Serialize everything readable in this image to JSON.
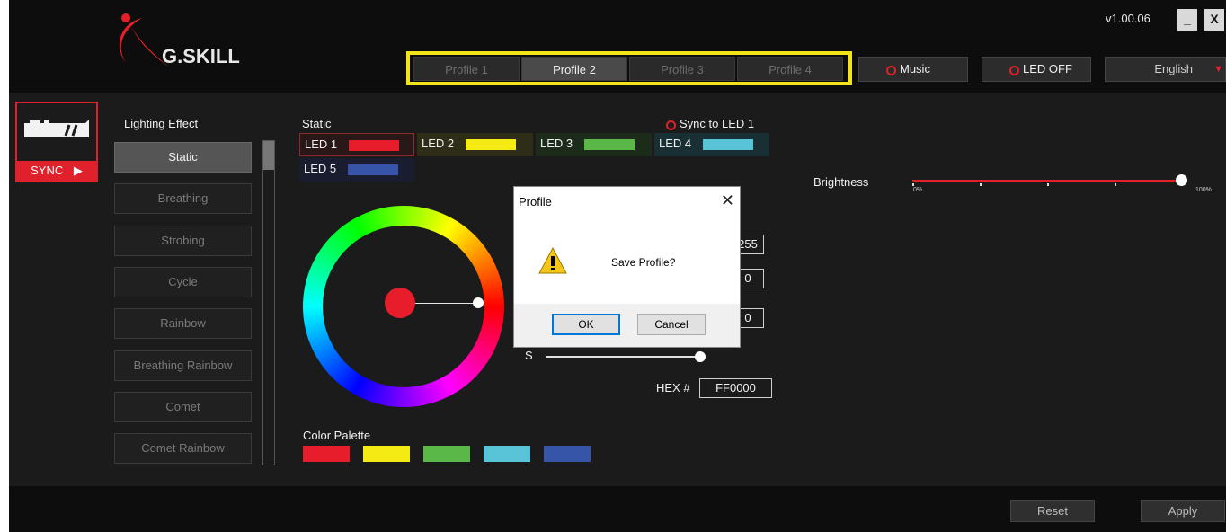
{
  "app": {
    "version": "v1.00.06",
    "minimize_label": "_",
    "close_label": "X",
    "logo_text": "G.SKILL"
  },
  "profiles": {
    "tabs": [
      "Profile 1",
      "Profile 2",
      "Profile 3",
      "Profile 4"
    ],
    "selected": "Profile 2"
  },
  "top_buttons": {
    "music": "Music",
    "led_off": "LED OFF",
    "language": "English"
  },
  "sidebar": {
    "sync_label": "SYNC"
  },
  "lighting": {
    "title": "Lighting Effect",
    "effects": [
      "Static",
      "Breathing",
      "Strobing",
      "Cycle",
      "Rainbow",
      "Breathing Rainbow",
      "Comet",
      "Comet Rainbow"
    ],
    "selected": "Static"
  },
  "static_panel": {
    "title": "Static",
    "sync_to_led": "Sync to LED 1",
    "leds": [
      {
        "label": "LED 1",
        "color": "#e71d2b"
      },
      {
        "label": "LED 2",
        "color": "#f4ea14"
      },
      {
        "label": "LED 3",
        "color": "#5ab849"
      },
      {
        "label": "LED 4",
        "color": "#59c3d8"
      },
      {
        "label": "LED 5",
        "color": "#3654a8"
      }
    ],
    "selected_led": "LED 1",
    "rgb": {
      "r": "255",
      "g": "0",
      "b": "0"
    },
    "s_label": "S",
    "hex_label": "HEX #",
    "hex_value": "FF0000",
    "palette_title": "Color Palette",
    "palette": [
      "#e71d2b",
      "#f4ea14",
      "#5ab849",
      "#59c3d8",
      "#3654a8"
    ]
  },
  "brightness": {
    "label": "Brightness",
    "min_label": "0%",
    "max_label": "100%",
    "value_percent": 100
  },
  "bottom": {
    "reset": "Reset",
    "apply": "Apply"
  },
  "dialog": {
    "title": "Profile",
    "close": "✕",
    "message": "Save Profile?",
    "ok": "OK",
    "cancel": "Cancel"
  },
  "colors": {
    "accent": "#e0202a",
    "highlight": "#f2e418"
  }
}
